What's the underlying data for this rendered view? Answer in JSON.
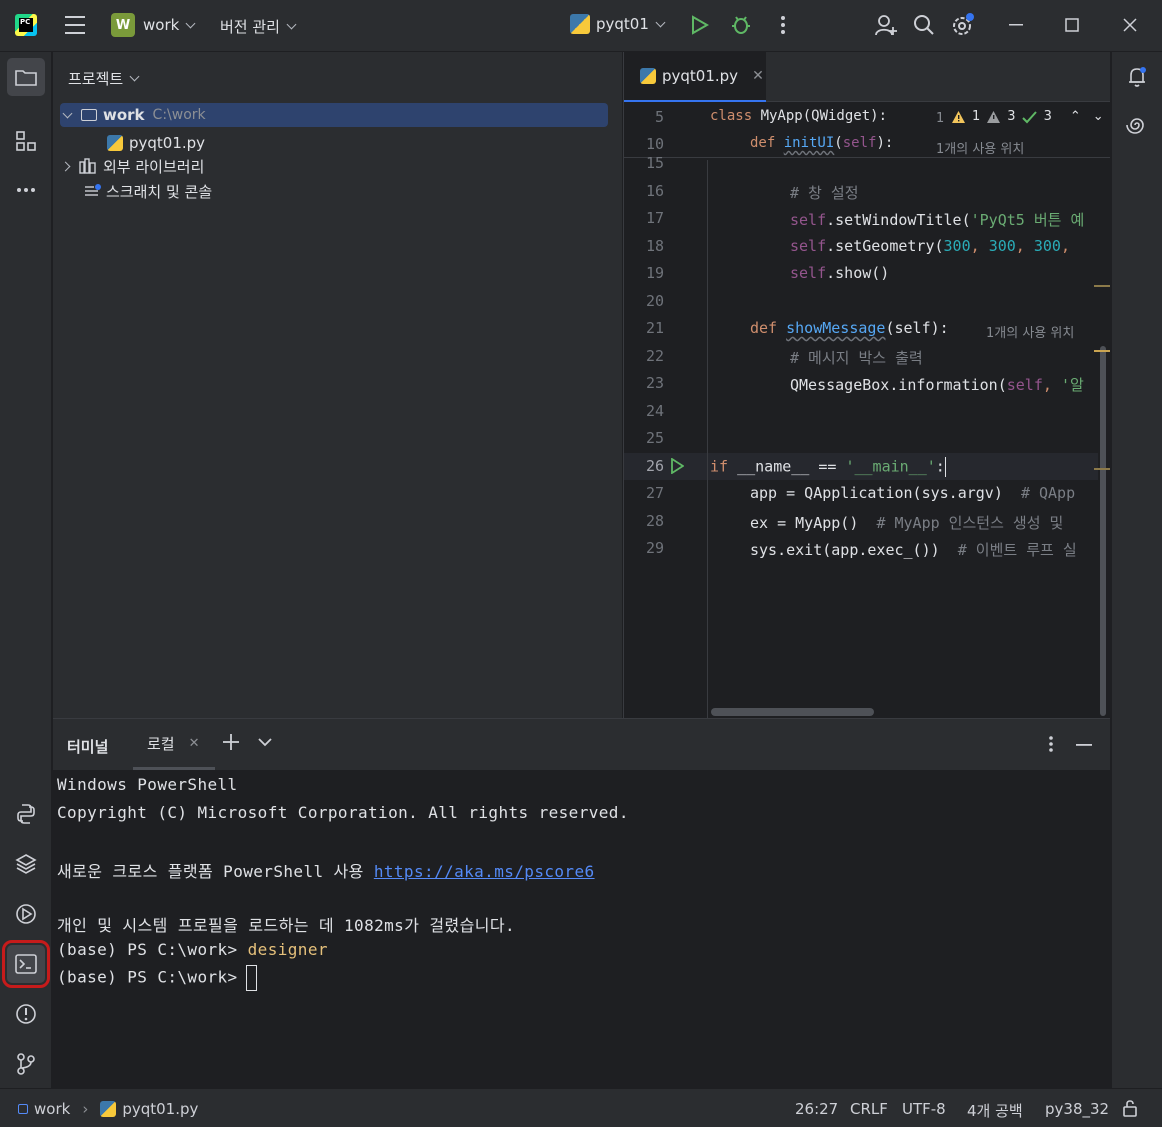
{
  "titlebar": {
    "project_badge": "W",
    "project_name": "work",
    "vcs_label": "버전 관리",
    "run_config": "pyqt01"
  },
  "project_panel": {
    "title": "프로젝트",
    "root_name": "work",
    "root_path": "C:\\work",
    "file": "pyqt01.py",
    "external_libs": "외부 라이브러리",
    "scratches": "스크래치 및 콘솔"
  },
  "editor": {
    "tab_label": "pyqt01.py",
    "inspection": {
      "info_count": "1",
      "warn_count1": "1",
      "warn_count2": "3",
      "ok_count": "3"
    },
    "sticky": [
      {
        "ln": "5",
        "text": "class MyApp(QWidget):",
        "hint": "1"
      },
      {
        "ln": "10",
        "text": "def initUI(self):",
        "hint": "1개의 사용 위치"
      }
    ],
    "lines": [
      {
        "ln": "15"
      },
      {
        "ln": "16",
        "comment": "# 창 설정"
      },
      {
        "ln": "17",
        "self": "self",
        "call": ".setWindowTitle(",
        "str": "'PyQt5 버튼 예"
      },
      {
        "ln": "18",
        "self": "self",
        "call": ".setGeometry(",
        "n1": "300",
        "n2": "300",
        "n3": "300"
      },
      {
        "ln": "19",
        "self": "self",
        "call": ".show()"
      },
      {
        "ln": "20"
      },
      {
        "ln": "21",
        "def": "def",
        "name": "showMessage",
        "args": "(self):",
        "hint": "1개의 사용 위치"
      },
      {
        "ln": "22",
        "comment": "# 메시지 박스 출력"
      },
      {
        "ln": "23",
        "call": "QMessageBox.information(",
        "self": "self",
        "str": "'알"
      },
      {
        "ln": "24"
      },
      {
        "ln": "25"
      },
      {
        "ln": "26",
        "kw": "if",
        "mid": " __name__ == ",
        "str": "'__main__'",
        "end": ":"
      },
      {
        "ln": "27",
        "code": "app = QApplication(sys.argv)",
        "comment": "# QApp"
      },
      {
        "ln": "28",
        "code": "ex = MyApp()",
        "comment": "# MyApp 인스턴스 생성 및"
      },
      {
        "ln": "29",
        "code": "sys.exit(app.exec_())",
        "comment": "# 이벤트 루프 실"
      }
    ]
  },
  "terminal": {
    "title": "터미널",
    "tab": "로컬",
    "lines": {
      "l1": "Windows PowerShell",
      "l2": "Copyright (C) Microsoft Corporation. All rights reserved.",
      "l3_pre": "새로운 크로스 플랫폼 PowerShell 사용 ",
      "l3_link": "https://aka.ms/pscore6",
      "l4": "개인 및 시스템 프로필을 로드하는 데 1082ms가 걸렸습니다.",
      "l5_prompt": "(base) PS C:\\work> ",
      "l5_cmd": "designer",
      "l6_prompt": "(base) PS C:\\work> "
    }
  },
  "statusbar": {
    "crumb_root": "work",
    "crumb_file": "pyqt01.py",
    "position": "26:27",
    "line_sep": "CRLF",
    "encoding": "UTF-8",
    "indent": "4개 공백",
    "interpreter": "py38_32"
  },
  "colors": {
    "accent": "#3574f0",
    "highlight_box": "#c61b1b",
    "background": "#1e1f22",
    "panel": "#2b2d30"
  }
}
